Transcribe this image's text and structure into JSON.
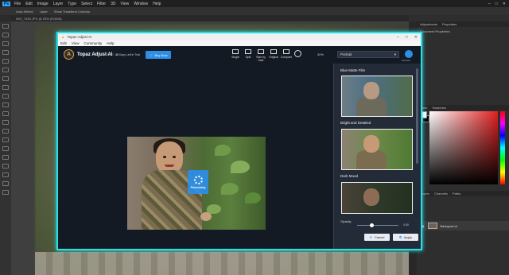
{
  "photoshop": {
    "menu": [
      "File",
      "Edit",
      "Image",
      "Layer",
      "Type",
      "Select",
      "Filter",
      "3D",
      "View",
      "Window",
      "Help"
    ],
    "logo": "Ps",
    "options_bar": [
      "Auto-Select:",
      "Layer",
      "Show Transform Controls"
    ],
    "doc_tab": "IMG_7335.JPG @ 25% (RGB/8)",
    "right_tabs": [
      "Adjustments",
      "Properties"
    ],
    "properties_label": "Document Properties",
    "color_tabs": [
      "Color",
      "Swatches"
    ],
    "layers_tabs": [
      "Layers",
      "Channels",
      "Paths"
    ],
    "layer_name": "Background"
  },
  "topaz": {
    "window_title": "Topaz Adjust AI",
    "window_controls": [
      "–",
      "□",
      "✕"
    ],
    "menu": [
      "Edit",
      "View",
      "Community",
      "Help"
    ],
    "app_logo": "A",
    "app_name": "Topaz Adjust AI",
    "version": "v1.0.0",
    "trial_days": "30",
    "trial_text": "Days Left in Trial",
    "buy_label": "Buy Now",
    "views": [
      "Single",
      "Split",
      "Side by Side",
      "Original",
      "Compare"
    ],
    "zoom": "30%",
    "preset": "Portrait",
    "account_label": "Account",
    "processing": "Processing",
    "presets": [
      {
        "name": "Blue Matte Film",
        "tone": "#4d6f86"
      },
      {
        "name": "Bright and Detailed",
        "tone": "#6e8a4c"
      },
      {
        "name": "Dark Mood",
        "tone": "#2f3a2a"
      }
    ],
    "opacity_label": "Opacity",
    "opacity_value": "0.60",
    "opacity_fraction": 0.35,
    "cancel_label": "Cancel",
    "apply_label": "Apply"
  },
  "colors": {
    "accent_blue": "#2b8fe8",
    "highlight_border": "#28e0e6",
    "logo_gold": "#e7a334"
  }
}
